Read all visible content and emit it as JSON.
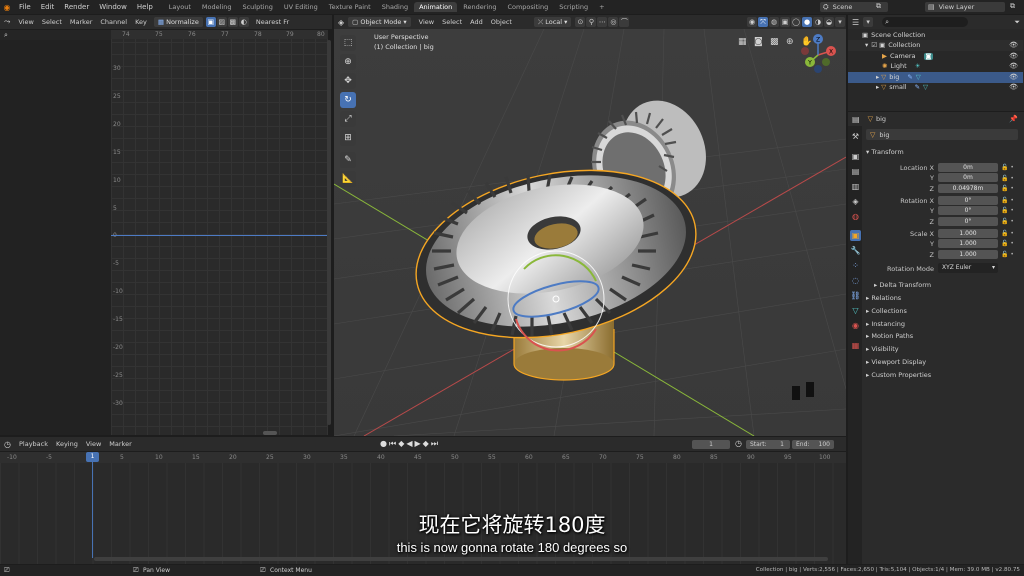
{
  "topbar": {
    "menus": [
      "File",
      "Edit",
      "Render",
      "Window",
      "Help"
    ],
    "workspaces": [
      "Layout",
      "Modeling",
      "Sculpting",
      "UV Editing",
      "Texture Paint",
      "Shading",
      "Animation",
      "Rendering",
      "Compositing",
      "Scripting"
    ],
    "active_workspace": "Animation",
    "add_tab": "+",
    "scene_label": "Scene",
    "view_layer_label": "View Layer"
  },
  "graph_editor": {
    "menus": [
      "View",
      "Select",
      "Marker",
      "Channel",
      "Key"
    ],
    "normalize_label": "Normalize",
    "interp_label": "Nearest Fr",
    "x_ticks": [
      "74",
      "75",
      "76",
      "77",
      "78",
      "79",
      "80"
    ],
    "y_ticks": [
      "30",
      "25",
      "20",
      "15",
      "10",
      "5",
      "0",
      "-5",
      "-10",
      "-15",
      "-20",
      "-25",
      "-30"
    ]
  },
  "viewport": {
    "mode_label": "Object Mode",
    "menus": [
      "View",
      "Select",
      "Add",
      "Object"
    ],
    "orientation_label": "Local",
    "perspective_label": "User Perspective",
    "collection_label": "(1) Collection | big",
    "axis_labels": {
      "x": "X",
      "y": "Y",
      "z": "Z"
    }
  },
  "outliner": {
    "root": "Scene Collection",
    "items": [
      {
        "name": "Collection"
      },
      {
        "name": "Camera"
      },
      {
        "name": "Light"
      },
      {
        "name": "big",
        "selected": true
      },
      {
        "name": "small"
      }
    ]
  },
  "properties": {
    "object_name": "big",
    "data_name": "big",
    "transform_header": "Transform",
    "location_label": "Location X",
    "rotation_label": "Rotation X",
    "scale_label": "Scale X",
    "y_label": "Y",
    "z_label": "Z",
    "location": [
      "0m",
      "0m",
      "0.04978m"
    ],
    "rotation": [
      "0°",
      "0°",
      "0°"
    ],
    "scale": [
      "1.000",
      "1.000",
      "1.000"
    ],
    "rotation_mode_label": "Rotation Mode",
    "rotation_mode_value": "XYZ Euler",
    "panels": [
      "Delta Transform",
      "Relations",
      "Collections",
      "Instancing",
      "Motion Paths",
      "Visibility",
      "Viewport Display",
      "Custom Properties"
    ]
  },
  "timeline": {
    "menus": [
      "Playback",
      "Keying",
      "View",
      "Marker"
    ],
    "current_frame": "1",
    "start_label": "Start:",
    "start_value": "1",
    "end_label": "End:",
    "end_value": "100",
    "ruler": [
      "-10",
      "-5",
      "1",
      "5",
      "10",
      "15",
      "20",
      "25",
      "30",
      "35",
      "40",
      "45",
      "50",
      "55",
      "60",
      "65",
      "70",
      "75",
      "80",
      "85",
      "90",
      "95",
      "100"
    ]
  },
  "statusbar": {
    "left_hint": "Pan View",
    "mid_hint": "Context Menu",
    "stats": "Collection | big | Verts:2,556 | Faces:2,650 | Tris:5,104 | Objects:1/4 | Mem: 39.0 MB | v2.80.75"
  },
  "subtitles": {
    "chinese": "现在它将旋转180度",
    "english": "this is now gonna rotate 180 degrees so"
  },
  "colors": {
    "selection_outline": "#f5a623",
    "blender_blue": "#4772b3",
    "x_axis": "#d9534f",
    "y_axis": "#8ab83a"
  }
}
